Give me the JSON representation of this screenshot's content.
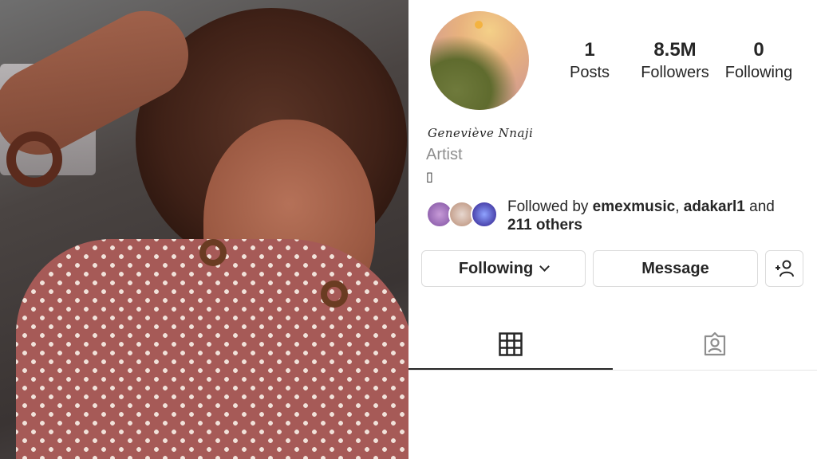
{
  "profile": {
    "display_name": "Geneviève Nnaji",
    "category": "Artist",
    "bio_icon": "▯",
    "stats": [
      {
        "value": "1",
        "label": "Posts"
      },
      {
        "value": "8.5M",
        "label": "Followers"
      },
      {
        "value": "0",
        "label": "Following"
      }
    ],
    "followed_by": {
      "prefix": "Followed by ",
      "user1": "emexmusic",
      "sep": ", ",
      "user2": "adakarl1",
      "conj": " and",
      "others": "211 others"
    },
    "buttons": {
      "following": "Following",
      "message": "Message"
    }
  },
  "icons": {
    "chevron": "chevron-down-icon",
    "add_user": "add-user-icon",
    "grid": "grid-icon",
    "tagged": "tagged-icon"
  },
  "colors": {
    "text": "#262626",
    "secondary_text": "#8e8e8e",
    "border": "#dbdbdb"
  }
}
